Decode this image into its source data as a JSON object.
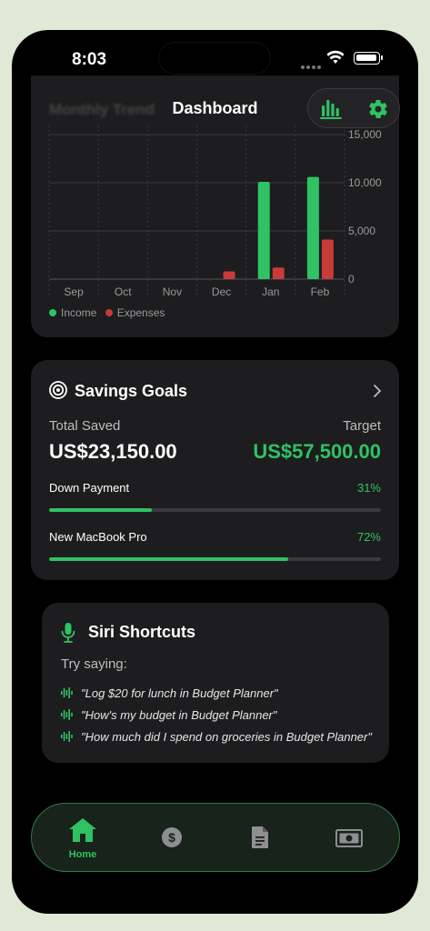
{
  "status": {
    "time": "8:03"
  },
  "header": {
    "title": "Dashboard",
    "faded_title": "Monthly Trend"
  },
  "colors": {
    "accent": "#30c263",
    "income": "#30c263",
    "expenses": "#c93a3a",
    "card": "#1d1d1f"
  },
  "chart_data": {
    "type": "bar",
    "categories": [
      "Sep",
      "Oct",
      "Nov",
      "Dec",
      "Jan",
      "Feb"
    ],
    "series": [
      {
        "name": "Income",
        "values": [
          0,
          0,
          0,
          0,
          10100,
          10600
        ]
      },
      {
        "name": "Expenses",
        "values": [
          0,
          0,
          0,
          800,
          1200,
          4100
        ]
      }
    ],
    "yticks": [
      "0",
      "5,000",
      "10,000",
      "15,000"
    ],
    "ylim": [
      0,
      15000
    ],
    "grid": true,
    "legend": "bottom-left"
  },
  "legend": {
    "income": "Income",
    "expenses": "Expenses"
  },
  "savings": {
    "title": "Savings Goals",
    "total_label": "Total Saved",
    "total_value": "US$23,150.00",
    "target_label": "Target",
    "target_value": "US$57,500.00",
    "goals": [
      {
        "name": "Down Payment",
        "percent": "31%",
        "fraction": 0.31
      },
      {
        "name": "New MacBook Pro",
        "percent": "72%",
        "fraction": 0.72
      }
    ]
  },
  "siri": {
    "title": "Siri Shortcuts",
    "prompt": "Try saying:",
    "phrases": [
      "\"Log $20 for lunch in Budget Planner\"",
      "\"How's my budget in Budget Planner\"",
      "\"How much did I spend on groceries in Budget Planner\""
    ]
  },
  "tabbar": {
    "tabs": [
      {
        "label": "Home",
        "icon": "home-icon",
        "active": true
      },
      {
        "label": "",
        "icon": "dollar-icon"
      },
      {
        "label": "",
        "icon": "document-icon"
      },
      {
        "label": "",
        "icon": "banknote-icon"
      }
    ]
  }
}
